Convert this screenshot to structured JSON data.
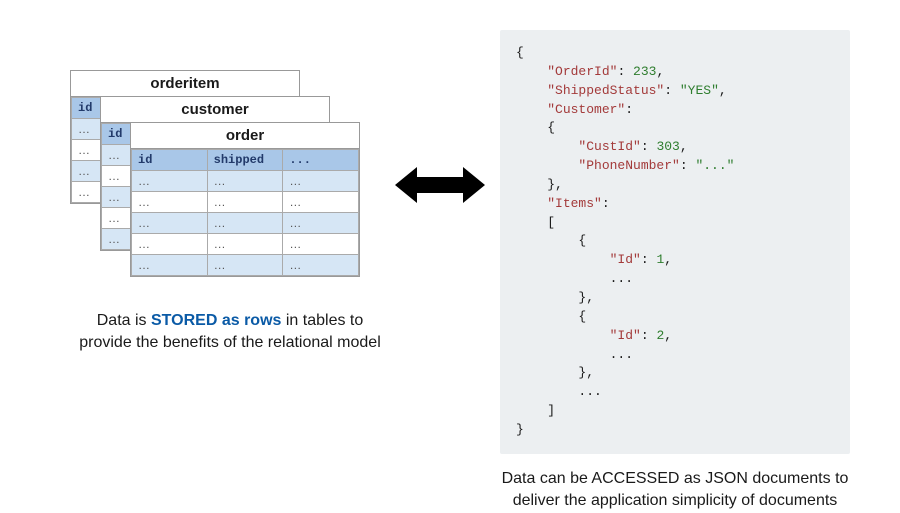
{
  "left": {
    "tables": [
      {
        "name": "orderitem",
        "headers": [
          "id"
        ]
      },
      {
        "name": "customer",
        "headers": [
          "id"
        ]
      },
      {
        "name": "order",
        "headers": [
          "id",
          "shipped",
          "..."
        ]
      }
    ],
    "rowPlaceholder": "…",
    "caption": {
      "pre": "Data is ",
      "em": "STORED as rows",
      "post": " in tables to provide the benefits of the relational model"
    }
  },
  "right": {
    "json": {
      "k_orderid": "\"OrderId\"",
      "v_orderid": "233",
      "k_shipped": "\"ShippedStatus\"",
      "v_shipped": "\"YES\"",
      "k_customer": "\"Customer\"",
      "k_custid": "\"CustId\"",
      "v_custid": "303",
      "k_phone": "\"PhoneNumber\"",
      "v_phone": "\"...\"",
      "k_items": "\"Items\"",
      "k_id": "\"Id\"",
      "v_id1": "1",
      "v_id2": "2",
      "ellipsis": "..."
    },
    "caption": {
      "pre": "Data can be ",
      "em": "ACCESSED as JSON documents",
      "post": " to deliver the application simplicity of documents"
    }
  }
}
